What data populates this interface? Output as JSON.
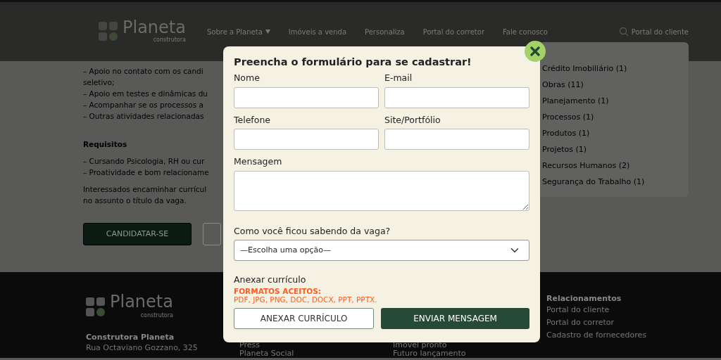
{
  "header": {
    "logo": {
      "name": "Planeta",
      "tagline": "construtora"
    },
    "nav": [
      {
        "label": "Sobre a Planeta",
        "has_caret": true
      },
      {
        "label": "Imóveis a venda",
        "has_caret": false
      },
      {
        "label": "Personaliza",
        "has_caret": false
      },
      {
        "label": "Portal do corretor",
        "has_caret": false
      },
      {
        "label": "Fale conosco",
        "has_caret": false
      }
    ],
    "client_link": "Portal do cliente"
  },
  "content": {
    "lines": [
      {
        "kind": "text",
        "text": "– Apoio no contato com os candi"
      },
      {
        "kind": "text",
        "text": "seletivo;"
      },
      {
        "kind": "text",
        "text": "– Apoio em testes e dinâmicas du"
      },
      {
        "kind": "text",
        "text": "– Acompanhar se os processos a"
      },
      {
        "kind": "text",
        "text": "– Outras atividades relacionadas"
      },
      {
        "kind": "heading",
        "text": "Requisitos"
      },
      {
        "kind": "text",
        "text": "– Cursando Psicologia, RH ou cur"
      },
      {
        "kind": "text",
        "text": "– Proatividade e bom relacioname"
      },
      {
        "kind": "para",
        "text": "Interessados encaminhar currícul"
      },
      {
        "kind": "text",
        "text": "no assunto o título da vaga."
      }
    ],
    "apply_button": "CANDIDATAR-SE"
  },
  "sidebar": {
    "categories": [
      "Crédito Imobiliário (1)",
      "Obras (11)",
      "Planejamento (1)",
      "Processos (1)",
      "Produtos (1)",
      "Projetos (1)",
      "Recursos Humanos (2)",
      "Segurança do Trabalho (1)"
    ]
  },
  "modal": {
    "title": "Preencha o formulário para se cadastrar!",
    "fields": [
      {
        "kind": "input",
        "label": "Nome"
      },
      {
        "kind": "input",
        "label": "E-mail"
      },
      {
        "kind": "input",
        "label": "Telefone"
      },
      {
        "kind": "input",
        "label": "Site/Portfólio"
      },
      {
        "kind": "textarea",
        "label": "Mensagem"
      },
      {
        "kind": "select",
        "label": "Como você ficou sabendo da vaga?",
        "value": "—Escolha uma opção—"
      }
    ],
    "attach_label": "Anexar currículo",
    "formats_title": "FORMATOS ACEITOS:",
    "formats": "PDF, JPG, PNG, DOC, DOCX, PPT, PPTX.",
    "attach_button": "ANEXAR CURRÍCULO",
    "send_button": "ENVIAR MENSAGEM"
  },
  "footer": {
    "logo": {
      "name": "Planeta",
      "tagline": "construtora"
    },
    "company": "Construtora Planeta",
    "address": "Rua Octaviano Gozzano, 325",
    "col2": [
      "Press",
      "Planeta Social"
    ],
    "col3": [
      "Imóvel pronto",
      "Futuro lançamento"
    ],
    "col4_title": "Relacionamentos",
    "col4": [
      "Portal do cliente",
      "Portal do corretor",
      "Cadastro de fornecedores"
    ]
  }
}
